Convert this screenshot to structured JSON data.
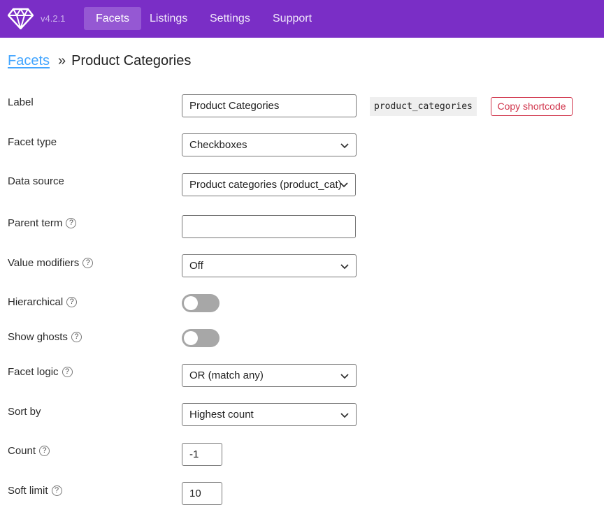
{
  "app": {
    "version": "v4.2.1",
    "nav": [
      {
        "label": "Facets",
        "active": true
      },
      {
        "label": "Listings",
        "active": false
      },
      {
        "label": "Settings",
        "active": false
      },
      {
        "label": "Support",
        "active": false
      }
    ],
    "brand_color": "#7a2ec6",
    "logo_icon": "diamond-icon"
  },
  "breadcrumb": {
    "link": "Facets",
    "separator": "»",
    "current": "Product Categories"
  },
  "form": {
    "label": {
      "label": "Label",
      "value": "Product Categories",
      "shortcode": "product_categories",
      "copy_button": "Copy shortcode"
    },
    "facet_type": {
      "label": "Facet type",
      "value": "Checkboxes"
    },
    "data_source": {
      "label": "Data source",
      "value": "Product categories (product_cat)"
    },
    "parent_term": {
      "label": "Parent term",
      "value": ""
    },
    "value_modifiers": {
      "label": "Value modifiers",
      "value": "Off"
    },
    "hierarchical": {
      "label": "Hierarchical",
      "enabled": false
    },
    "show_ghosts": {
      "label": "Show ghosts",
      "enabled": false
    },
    "facet_logic": {
      "label": "Facet logic",
      "value": "OR (match any)"
    },
    "sort_by": {
      "label": "Sort by",
      "value": "Highest count"
    },
    "count": {
      "label": "Count",
      "value": "-1"
    },
    "soft_limit": {
      "label": "Soft limit",
      "value": "10"
    }
  },
  "help_glyph": "?"
}
